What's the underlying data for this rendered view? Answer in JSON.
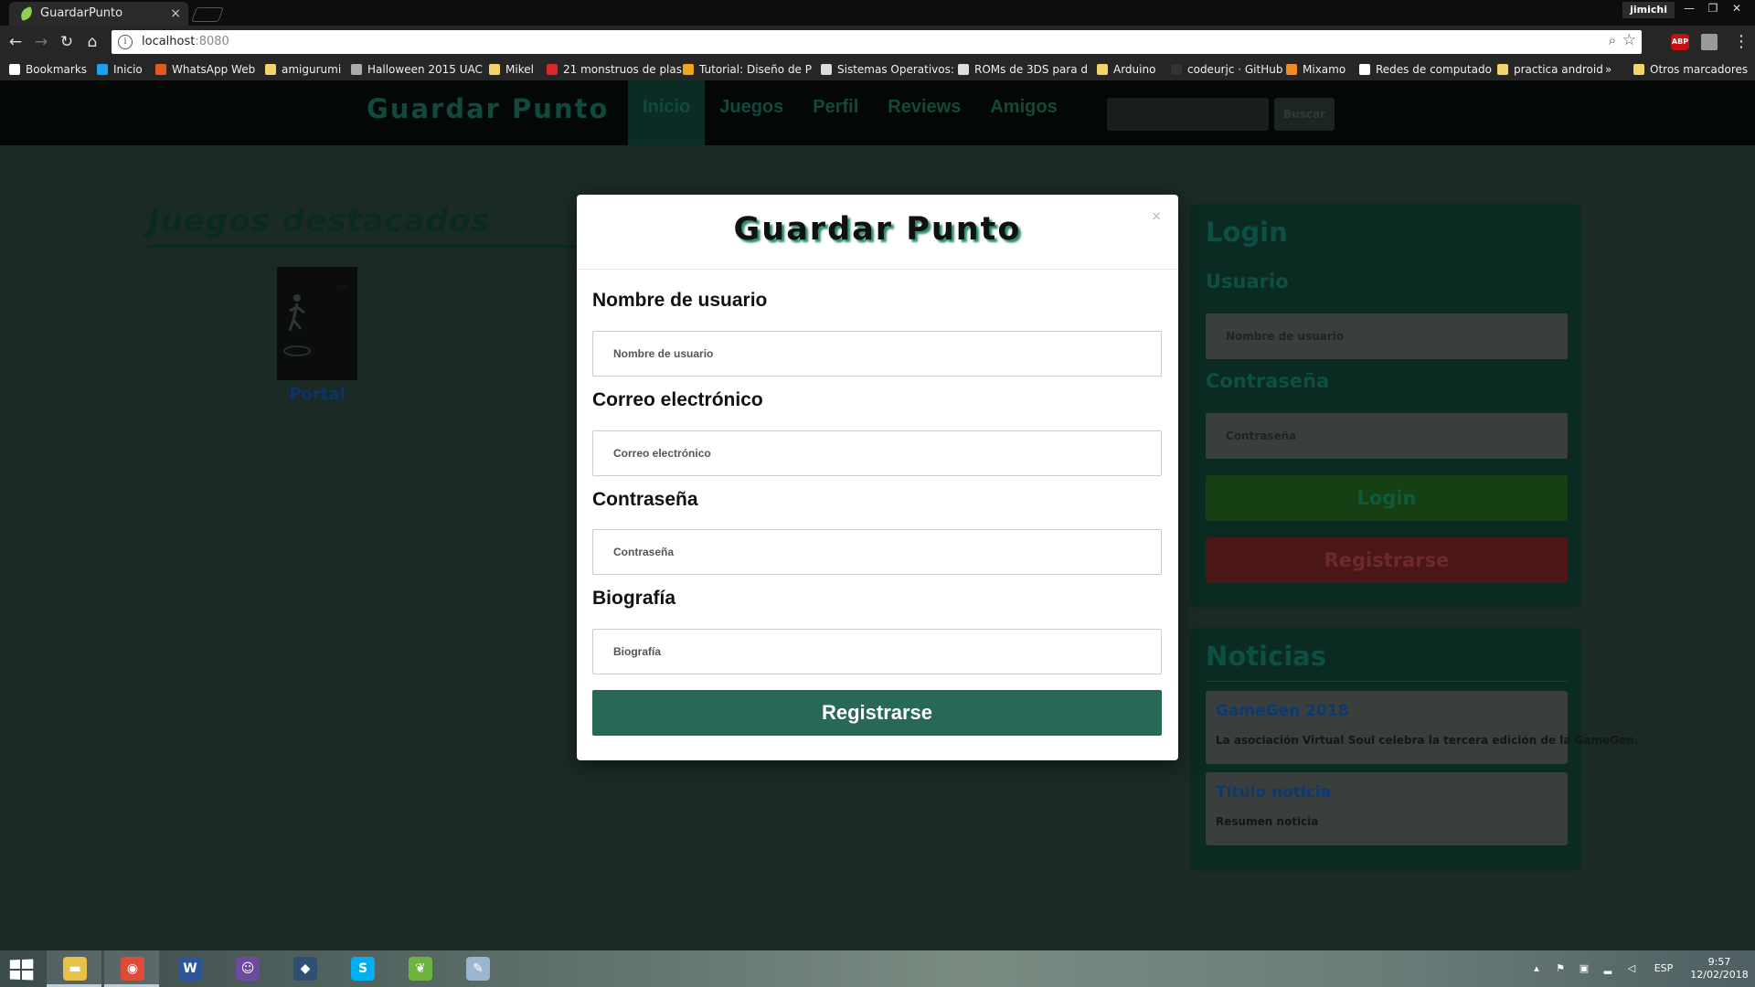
{
  "browser": {
    "tab_title": "GuardarPunto",
    "tab_close": "×",
    "user": "jimichi",
    "url_host": "localhost",
    "url_port": ":8080",
    "window_controls": [
      "—",
      "❐",
      "✕"
    ],
    "bookmarks": [
      {
        "label": "Bookmarks",
        "icon": "star-icon",
        "color": "#ffffff"
      },
      {
        "label": "Inicio",
        "icon": "twitter-icon",
        "color": "#1da1f2"
      },
      {
        "label": "WhatsApp Web",
        "icon": "whatsapp-icon",
        "color": "#e25a1c"
      },
      {
        "label": "amigurumi",
        "icon": "folder-icon",
        "color": "#f2d46b"
      },
      {
        "label": "Halloween 2015 UAC",
        "icon": "page-icon",
        "color": "#aaaaaa"
      },
      {
        "label": "Mikel",
        "icon": "folder-icon",
        "color": "#f2d46b"
      },
      {
        "label": "21 monstruos de plas",
        "icon": "page-icon",
        "color": "#d62a2a"
      },
      {
        "label": "Tutorial: Diseño de P",
        "icon": "page-icon",
        "color": "#f2a71b"
      },
      {
        "label": "Sistemas Operativos:",
        "icon": "page-icon",
        "color": "#dddddd"
      },
      {
        "label": "ROMs de 3DS para d",
        "icon": "page-icon",
        "color": "#dddddd"
      },
      {
        "label": "Arduino",
        "icon": "folder-icon",
        "color": "#f2d46b"
      },
      {
        "label": "codeurjc · GitHub",
        "icon": "github-icon",
        "color": "#333333"
      },
      {
        "label": "Mixamo",
        "icon": "mixamo-icon",
        "color": "#f08a24"
      },
      {
        "label": "Redes de computado",
        "icon": "page-icon",
        "color": "#ffffff"
      },
      {
        "label": "practica android",
        "icon": "folder-icon",
        "color": "#f2d46b"
      }
    ],
    "bookmarks_overflow": "»",
    "other_bookmarks": "Otros marcadores"
  },
  "site": {
    "brand": "Guardar Punto",
    "nav": [
      "Inicio",
      "Juegos",
      "Perfil",
      "Reviews",
      "Amigos"
    ],
    "search_button": "Buscar",
    "featured_title": "Juegos destacados",
    "featured_game": "Portal",
    "login": {
      "title": "Login",
      "user_label": "Usuario",
      "user_placeholder": "Nombre de usuario",
      "pass_label": "Contraseña",
      "pass_placeholder": "Contraseña",
      "login_button": "Login",
      "register_button": "Registrarse"
    },
    "news": {
      "title": "Noticias",
      "items": [
        {
          "title": "GameGen 2018",
          "summary": "La asociación Virtual Soul celebra la tercera edición de la GameGen."
        },
        {
          "title": "Título noticia",
          "summary": "Resumen noticia"
        }
      ]
    }
  },
  "modal": {
    "title": "Guardar Punto",
    "close": "×",
    "fields": [
      {
        "label": "Nombre de usuario",
        "placeholder": "Nombre de usuario"
      },
      {
        "label": "Correo electrónico",
        "placeholder": "Correo electrónico"
      },
      {
        "label": "Contraseña",
        "placeholder": "Contraseña"
      },
      {
        "label": "Biografía",
        "placeholder": "Biografía"
      }
    ],
    "submit": "Registrarse"
  },
  "taskbar": {
    "apps": [
      {
        "name": "file-explorer",
        "color": "#e8c14a",
        "glyph": "▬"
      },
      {
        "name": "chrome",
        "color": "#dd4b39",
        "glyph": "◉"
      },
      {
        "name": "word",
        "color": "#2b579a",
        "glyph": "W"
      },
      {
        "name": "github-desktop",
        "color": "#6e4a9e",
        "glyph": "☺"
      },
      {
        "name": "mysql-workbench",
        "color": "#2c4f73",
        "glyph": "◆"
      },
      {
        "name": "skype",
        "color": "#00aff0",
        "glyph": "S"
      },
      {
        "name": "spring-tool-suite",
        "color": "#6db33f",
        "glyph": "❦"
      },
      {
        "name": "paint",
        "color": "#9ab6d0",
        "glyph": "✎"
      }
    ],
    "language": "ESP",
    "time": "9:57",
    "date": "12/02/2018"
  }
}
